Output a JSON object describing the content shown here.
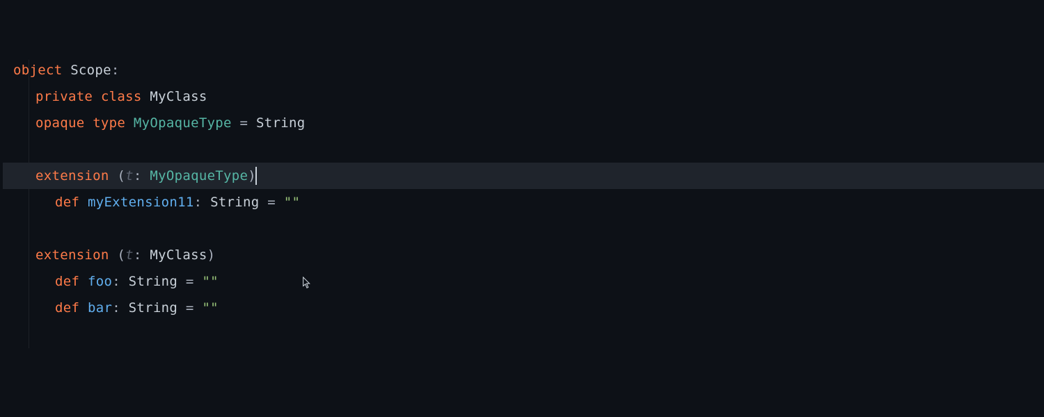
{
  "code": {
    "l1": {
      "object": "object",
      "space": " ",
      "scope": "Scope",
      "colon": ":"
    },
    "l2": {
      "private": "private",
      "class": "class",
      "space": " ",
      "myclass": "MyClass"
    },
    "l3": {
      "opaque": "opaque",
      "type": "type",
      "space": " ",
      "name": "MyOpaqueType",
      "eq": " = ",
      "rhs": "String"
    },
    "l5": {
      "extension": "extension",
      "space": " ",
      "lp": "(",
      "param": "t",
      "colon": ": ",
      "ptype": "MyOpaqueType",
      "rp": ")"
    },
    "l6": {
      "def": "def",
      "space": " ",
      "name": "myExtension11",
      "colon": ": ",
      "rtype": "String",
      "eq": " = ",
      "val": "\"\""
    },
    "l8": {
      "extension": "extension",
      "space": " ",
      "lp": "(",
      "param": "t",
      "colon": ": ",
      "ptype": "MyClass",
      "rp": ")"
    },
    "l9": {
      "def": "def",
      "space": " ",
      "name": "foo",
      "colon": ": ",
      "rtype": "String",
      "eq": " = ",
      "val": "\"\""
    },
    "l10": {
      "def": "def",
      "space": " ",
      "name": "bar",
      "colon": ": ",
      "rtype": "String",
      "eq": " = ",
      "val": "\"\""
    }
  }
}
